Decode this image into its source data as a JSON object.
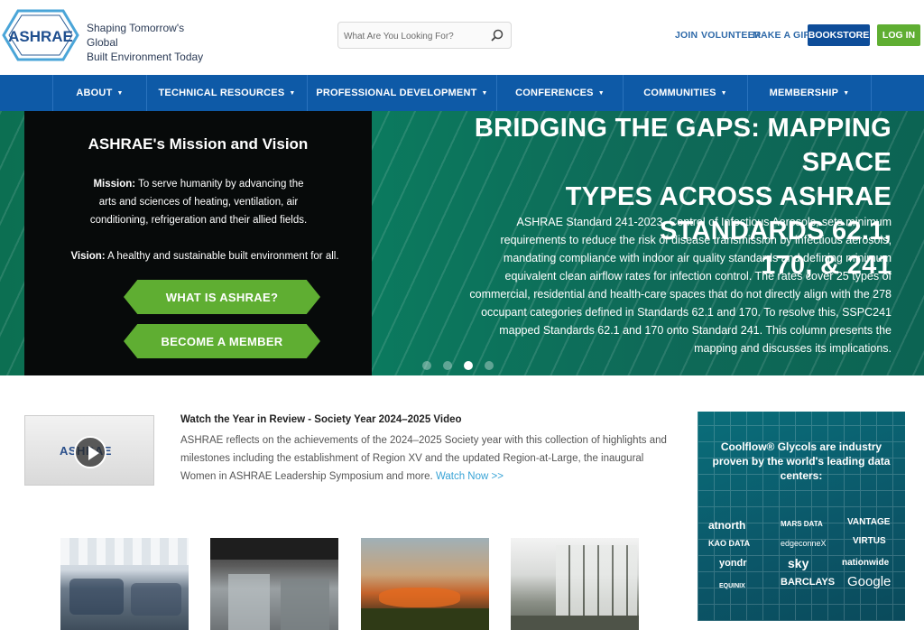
{
  "header": {
    "logo_text": "ASHRAE",
    "tagline_line1": "Shaping Tomorrow's Global",
    "tagline_line2": "Built Environment Today",
    "search_placeholder": "What Are You Looking For?",
    "links": [
      "JOIN",
      "VOLUNTEER",
      "MAKE A GIFT"
    ],
    "bookstore_label": "BOOKSTORE",
    "login_label": "LOG IN"
  },
  "nav": {
    "items": [
      "ABOUT",
      "TECHNICAL RESOURCES",
      "PROFESSIONAL DEVELOPMENT",
      "CONFERENCES",
      "COMMUNITIES",
      "MEMBERSHIP"
    ]
  },
  "mission": {
    "title": "ASHRAE's Mission and Vision",
    "mission_label": "Mission:",
    "mission_text": " To serve humanity by advancing the arts and sciences of heating, ventilation, air conditioning, refrigeration and their allied fields.",
    "vision_label": "Vision:",
    "vision_text": " A healthy and sustainable built environment for all.",
    "btn_what": "WHAT IS ASHRAE?",
    "btn_member": "BECOME A MEMBER"
  },
  "hero": {
    "title_line1": "BRIDGING THE GAPS: MAPPING SPACE",
    "title_line2": "TYPES ACROSS ASHRAE STANDARDS 62.1,",
    "title_line3": "170, & 241",
    "body": "ASHRAE Standard 241-2023, Control of Infectious Aerosols, sets minimum requirements to reduce the risk of disease transmission by infectious aerosols, mandating compliance with indoor air quality standards and defining minimum equivalent clean airflow rates for infection control. The rates cover 25 types of commercial, residential and health-care spaces that do not directly align with the 278 occupant categories defined in Standards 62.1 and 170. To resolve this, SSPC241 mapped Standards 62.1 and 170 onto Standard 241. This column presents the mapping and discusses its implications."
  },
  "video": {
    "thumb_logo": "ASHRAE",
    "title": "Watch the Year in Review - Society Year 2024–2025 Video",
    "desc": "ASHRAE reflects on the achievements of the 2024–2025 Society year with this collection of highlights and milestones including the establishment of Region XV and the updated Region-at-Large, the inaugural Women in ASHRAE Leadership Symposium and more. ",
    "link": "Watch Now >>"
  },
  "ad": {
    "headline": "Coolflow® Glycols are industry proven by the world's leading data centers:",
    "logos": [
      "atnorth",
      "MARS DATA",
      "VANTAGE",
      "KAO DATA",
      "edgeconneX",
      "VIRTUS",
      "yondr",
      "sky",
      "nationwide",
      "EQUINIX",
      "BARCLAYS",
      "Google"
    ]
  }
}
